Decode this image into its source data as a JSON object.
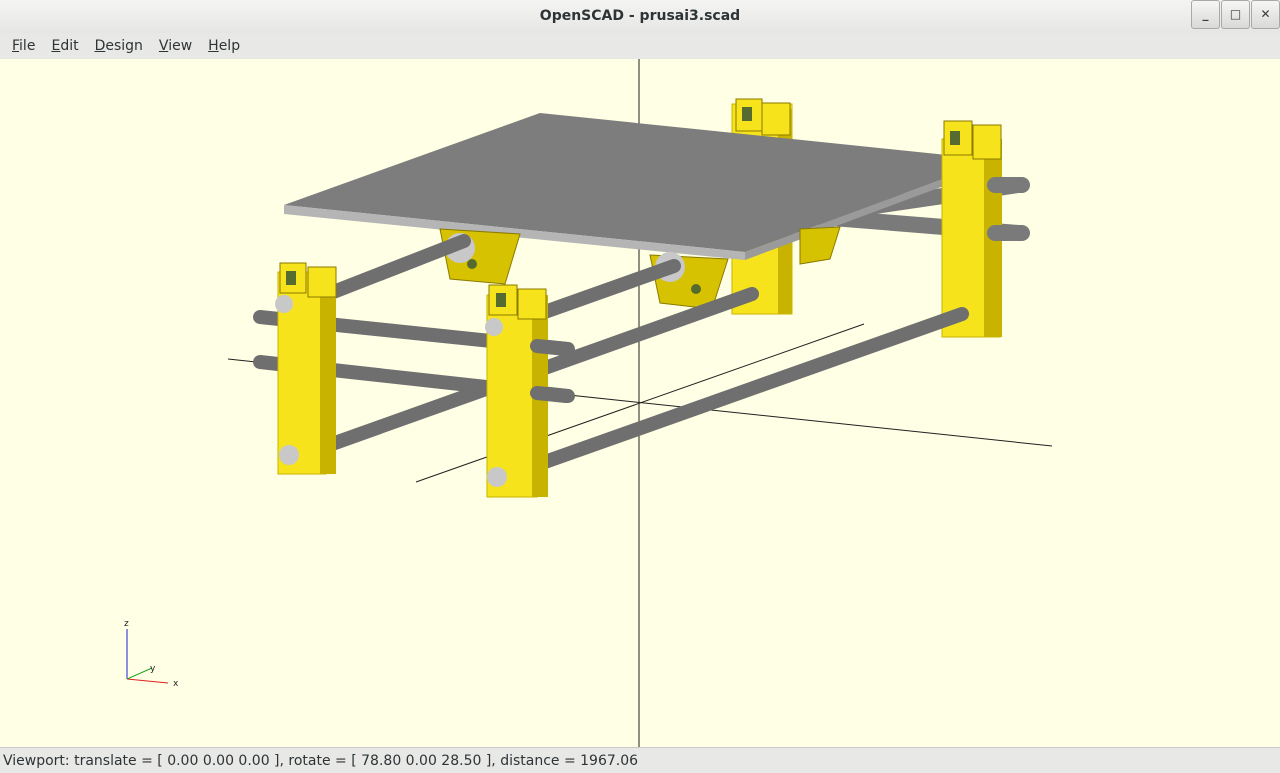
{
  "window": {
    "title": "OpenSCAD - prusai3.scad",
    "controls": [
      {
        "name": "minimize-button",
        "icon": "minimize-icon",
        "glyph": "_"
      },
      {
        "name": "maximize-button",
        "icon": "maximize-icon",
        "glyph": "□"
      },
      {
        "name": "close-button",
        "icon": "close-icon",
        "glyph": "✕"
      }
    ]
  },
  "menu": [
    {
      "label": "File",
      "mnemonic": "F",
      "rest": "ile"
    },
    {
      "label": "Edit",
      "mnemonic": "E",
      "rest": "dit"
    },
    {
      "label": "Design",
      "mnemonic": "D",
      "rest": "esign"
    },
    {
      "label": "View",
      "mnemonic": "V",
      "rest": "iew"
    },
    {
      "label": "Help",
      "mnemonic": "H",
      "rest": "elp"
    }
  ],
  "viewport": {
    "background": "#ffffe5",
    "axes_indicator": {
      "x": "x",
      "y": "y",
      "z": "z"
    },
    "colors": {
      "frame": "#f7e31c",
      "frame_shade": "#c8b400",
      "rod": "#7a7a7a",
      "rod_end": "#c8c8c8",
      "bed": "#7d7d7d",
      "bed_edge": "#b5b5b5",
      "axis_line": "#202020",
      "axis_x": "#e02020",
      "axis_y": "#20a020",
      "axis_z": "#2020e0"
    }
  },
  "status": {
    "text": "Viewport: translate = [ 0.00 0.00 0.00 ], rotate = [ 78.80 0.00 28.50 ], distance = 1967.06"
  }
}
